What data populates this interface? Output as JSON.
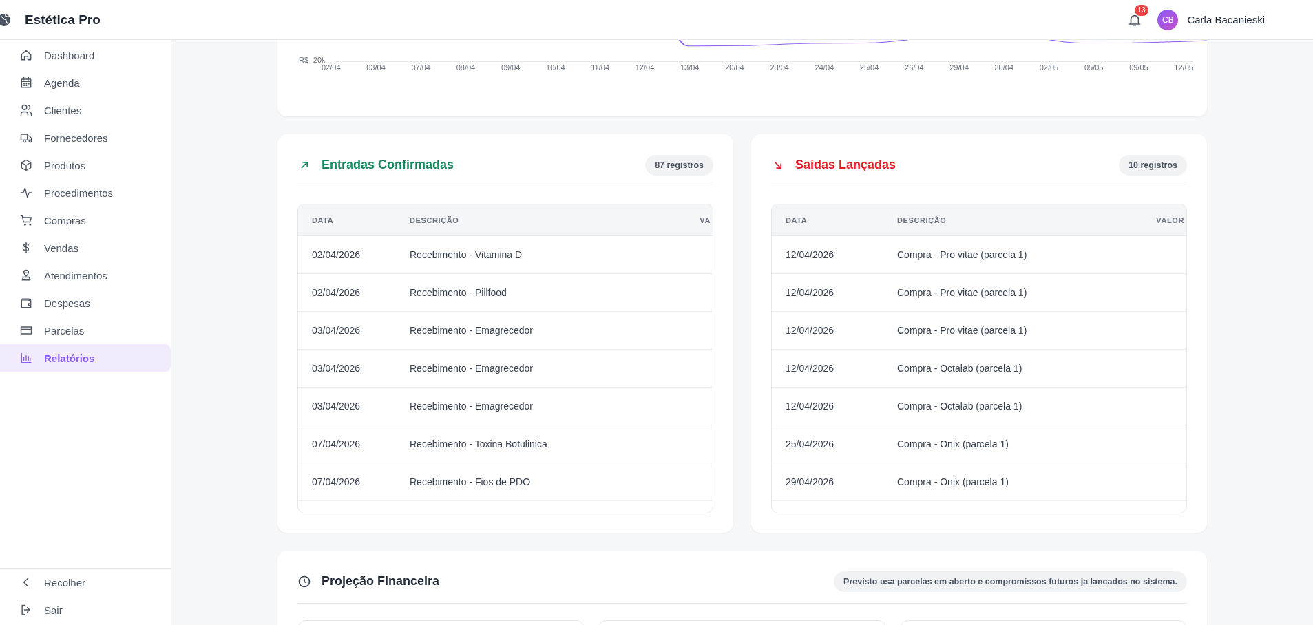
{
  "app": {
    "name": "Estética Pro"
  },
  "header": {
    "notifications": "13",
    "user_initials": "CB",
    "user_name": "Carla Bacanieski"
  },
  "sidebar": {
    "items": [
      {
        "label": "Dashboard",
        "selected": false
      },
      {
        "label": "Agenda",
        "selected": false
      },
      {
        "label": "Clientes",
        "selected": false
      },
      {
        "label": "Fornecedores",
        "selected": false
      },
      {
        "label": "Produtos",
        "selected": false
      },
      {
        "label": "Procedimentos",
        "selected": false
      },
      {
        "label": "Compras",
        "selected": false
      },
      {
        "label": "Vendas",
        "selected": false
      },
      {
        "label": "Atendimentos",
        "selected": false
      },
      {
        "label": "Despesas",
        "selected": false
      },
      {
        "label": "Parcelas",
        "selected": false
      },
      {
        "label": "Relatórios",
        "selected": true
      }
    ],
    "footer": [
      {
        "label": "Recolher"
      },
      {
        "label": "Sair"
      }
    ]
  },
  "chart": {
    "y_tick": "R$ -20k",
    "x_labels": [
      "02/04",
      "03/04",
      "07/04",
      "08/04",
      "09/04",
      "10/04",
      "11/04",
      "12/04",
      "13/04",
      "20/04",
      "23/04",
      "24/04",
      "25/04",
      "26/04",
      "29/04",
      "30/04",
      "02/05",
      "05/05",
      "09/05",
      "12/05"
    ]
  },
  "panels": [
    {
      "kind": "in",
      "title": "Entradas Confirmadas",
      "count": "87 registros",
      "columns": [
        "DATA",
        "DESCRIÇÃO",
        "VA"
      ],
      "rows": [
        [
          "02/04/2026",
          "Recebimento - Vitamina D"
        ],
        [
          "02/04/2026",
          "Recebimento - Pillfood"
        ],
        [
          "03/04/2026",
          "Recebimento - Emagrecedor"
        ],
        [
          "03/04/2026",
          "Recebimento - Emagrecedor"
        ],
        [
          "03/04/2026",
          "Recebimento - Emagrecedor"
        ],
        [
          "07/04/2026",
          "Recebimento - Toxina Botulinica"
        ],
        [
          "07/04/2026",
          "Recebimento - Fios de PDO"
        ]
      ]
    },
    {
      "kind": "out",
      "title": "Saídas Lançadas",
      "count": "10 registros",
      "columns": [
        "DATA",
        "DESCRIÇÃO",
        "VALOR"
      ],
      "rows": [
        [
          "12/04/2026",
          "Compra - Pro vitae (parcela 1)"
        ],
        [
          "12/04/2026",
          "Compra - Pro vitae (parcela 1)"
        ],
        [
          "12/04/2026",
          "Compra - Pro vitae (parcela 1)"
        ],
        [
          "12/04/2026",
          "Compra - Octalab (parcela 1)"
        ],
        [
          "12/04/2026",
          "Compra - Octalab (parcela 1)"
        ],
        [
          "25/04/2026",
          "Compra - Onix (parcela 1)"
        ],
        [
          "29/04/2026",
          "Compra - Onix (parcela 1)"
        ]
      ]
    }
  ],
  "projection": {
    "title": "Projeção Financeira",
    "note": "Previsto usa parcelas em aberto e compromissos futuros ja lancados no sistema."
  }
}
